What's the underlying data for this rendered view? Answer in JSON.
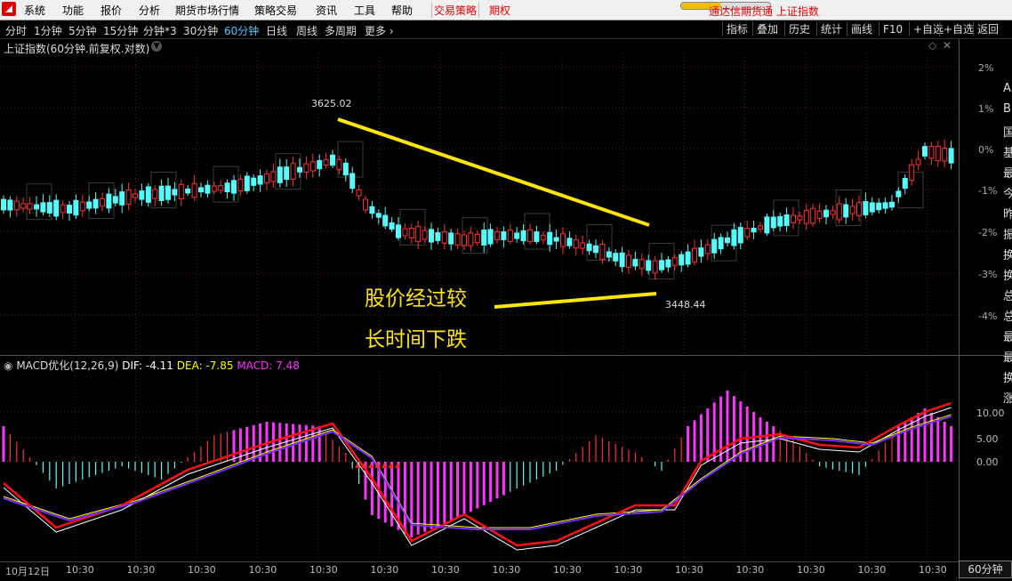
{
  "menubar": {
    "items": [
      "系统",
      "功能",
      "报价",
      "分析",
      "期货市场行情",
      "策略交易",
      "资讯",
      "工具",
      "帮助",
      "交易策略",
      "期权"
    ],
    "status_text": "通达信期货通  上证指数",
    "progress": 0.45
  },
  "period_bar": {
    "periods": [
      "分时",
      "1分钟",
      "5分钟",
      "15分钟",
      "分钟*3",
      "30分钟",
      "60分钟",
      "日线",
      "周线",
      "多周期",
      "更多 ›"
    ],
    "active": "60分钟",
    "tools": [
      "指标",
      "叠加",
      "历史",
      "统计",
      "画线",
      "F10",
      "+自选",
      "返回"
    ]
  },
  "chart": {
    "title": "上证指数(60分钟.前复权.对数)",
    "high_label": "3625.02",
    "low_label": "3448.44",
    "pct_ticks": [
      "2%",
      "1%",
      "0%",
      "-1%",
      "-2%",
      "-3%",
      "-4%"
    ],
    "annotation_line1": "股价经过较",
    "annotation_line2": "长时间下跌",
    "colors": {
      "up": "#ff3030",
      "down": "#54fcfc",
      "trend": "#ffe600"
    }
  },
  "macd": {
    "name": "MACD优化(12,26,9)",
    "dif_label": "DIF: -4.11",
    "dea_label": "DEA: -7.85",
    "macd_label": "MACD: 7.48",
    "ticks": [
      "10.00",
      "5.00",
      "0.00"
    ],
    "colors": {
      "dif": "#ffffff",
      "dea": "#ffff00",
      "hist_up": "#ff3030",
      "hist_down": "#54fcfc",
      "hist_strong": "#ff33ff",
      "dif_line2": "#ff0000",
      "dea_line2": "#8833ff"
    }
  },
  "xaxis": {
    "first": "10月12日",
    "labels": [
      "10:30",
      "10:30",
      "10:30",
      "10:30",
      "10:30",
      "10:30",
      "10:30",
      "10:30",
      "10:30",
      "10:30",
      "10:30",
      "10:30",
      "10:30",
      "10:30",
      "10:30",
      "10:30"
    ]
  },
  "period_badge": "60分钟",
  "side_chars": [
    "A",
    "B",
    "国",
    "基",
    "最",
    "今",
    "昨",
    "振",
    "换",
    "换",
    "总",
    "总",
    "最",
    "最",
    "换",
    "涨"
  ]
}
